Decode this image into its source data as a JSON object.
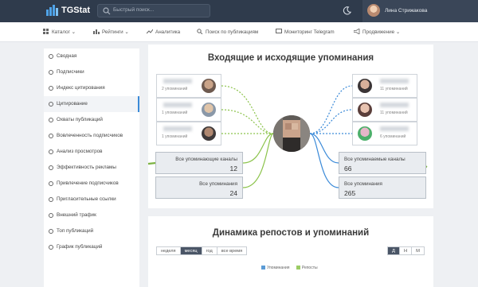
{
  "header": {
    "logo_text": "TGStat",
    "search_placeholder": "Быстрый поиск...",
    "user_name": "Лина Стрижакова"
  },
  "nav": {
    "items": [
      {
        "label": "Каталог",
        "icon": "grid-icon",
        "dropdown": true
      },
      {
        "label": "Рейтинги",
        "icon": "chart-icon",
        "dropdown": true
      },
      {
        "label": "Аналитика",
        "icon": "analytics-icon",
        "dropdown": false
      },
      {
        "label": "Поиск по публикациям",
        "icon": "search-icon",
        "dropdown": false
      },
      {
        "label": "Мониторинг Telegram",
        "icon": "monitor-icon",
        "dropdown": false
      },
      {
        "label": "Продвижение",
        "icon": "megaphone-icon",
        "dropdown": true
      }
    ]
  },
  "sidebar": {
    "items": [
      {
        "label": "Сводная",
        "active": false
      },
      {
        "label": "Подписчики",
        "active": false
      },
      {
        "label": "Индекс цитирования",
        "active": false
      },
      {
        "label": "Цитирование",
        "active": true
      },
      {
        "label": "Охваты публикаций",
        "active": false
      },
      {
        "label": "Вовлеченность подписчиков",
        "active": false
      },
      {
        "label": "Анализ просмотров",
        "active": false
      },
      {
        "label": "Эффективность рекламы",
        "active": false
      },
      {
        "label": "Привлечение подписчиков",
        "active": false
      },
      {
        "label": "Пригласительные ссылки",
        "active": false
      },
      {
        "label": "Внешний трафик",
        "active": false
      },
      {
        "label": "Топ публикаций",
        "active": false
      },
      {
        "label": "График публикаций",
        "active": false
      }
    ]
  },
  "mentions": {
    "title": "Входящие и исходящие упоминания",
    "incoming": [
      {
        "sub": "2 упоминаний"
      },
      {
        "sub": "1 упоминаний"
      },
      {
        "sub": "1 упоминаний"
      }
    ],
    "outgoing": [
      {
        "sub": "11 упоминаний"
      },
      {
        "sub": "11 упоминаний"
      },
      {
        "sub": "6 упоминаний"
      }
    ],
    "incoming_total": {
      "label": "Все упоминающие каналы",
      "value": "12"
    },
    "incoming_all": {
      "label": "Все упоминания",
      "value": "24"
    },
    "outgoing_total": {
      "label": "Все упоминаемые каналы",
      "value": "66"
    },
    "outgoing_all": {
      "label": "Все упоминания",
      "value": "265"
    },
    "colors": {
      "incoming": "#8bc34a",
      "outgoing": "#3b8ad8",
      "arrow": "#7cb342"
    }
  },
  "dynamics": {
    "title": "Динамика репостов и упоминаний",
    "periods": [
      {
        "label": "неделя",
        "active": false
      },
      {
        "label": "месяц",
        "active": true
      },
      {
        "label": "год",
        "active": false
      },
      {
        "label": "все время",
        "active": false
      }
    ],
    "granularity": [
      {
        "label": "Д",
        "active": true
      },
      {
        "label": "Н",
        "active": false
      },
      {
        "label": "М",
        "active": false
      }
    ],
    "legend": [
      {
        "label": "Упоминания",
        "color": "#5b9bd5"
      },
      {
        "label": "Репосты",
        "color": "#9ccc65"
      }
    ]
  }
}
